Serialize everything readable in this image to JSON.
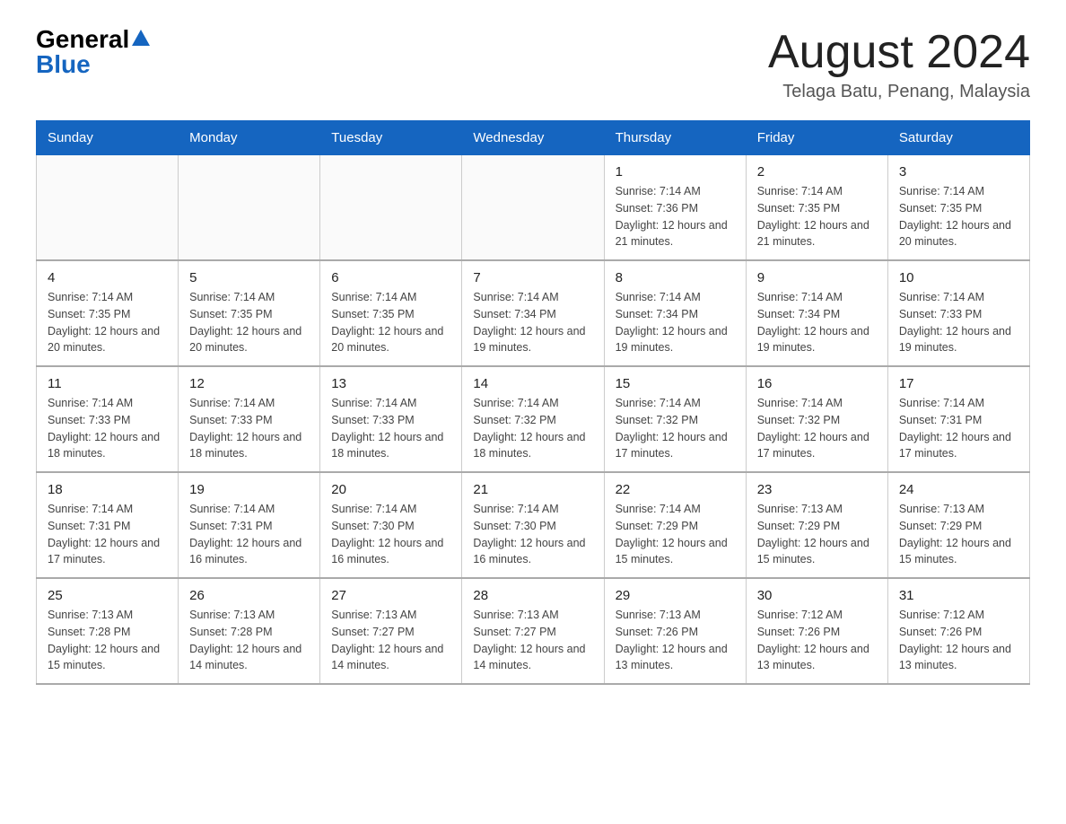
{
  "header": {
    "logo_text_general": "General",
    "logo_text_blue": "Blue",
    "title": "August 2024",
    "subtitle": "Telaga Batu, Penang, Malaysia"
  },
  "days_of_week": [
    "Sunday",
    "Monday",
    "Tuesday",
    "Wednesday",
    "Thursday",
    "Friday",
    "Saturday"
  ],
  "weeks": [
    [
      {
        "day": "",
        "info": ""
      },
      {
        "day": "",
        "info": ""
      },
      {
        "day": "",
        "info": ""
      },
      {
        "day": "",
        "info": ""
      },
      {
        "day": "1",
        "info": "Sunrise: 7:14 AM\nSunset: 7:36 PM\nDaylight: 12 hours and 21 minutes."
      },
      {
        "day": "2",
        "info": "Sunrise: 7:14 AM\nSunset: 7:35 PM\nDaylight: 12 hours and 21 minutes."
      },
      {
        "day": "3",
        "info": "Sunrise: 7:14 AM\nSunset: 7:35 PM\nDaylight: 12 hours and 20 minutes."
      }
    ],
    [
      {
        "day": "4",
        "info": "Sunrise: 7:14 AM\nSunset: 7:35 PM\nDaylight: 12 hours and 20 minutes."
      },
      {
        "day": "5",
        "info": "Sunrise: 7:14 AM\nSunset: 7:35 PM\nDaylight: 12 hours and 20 minutes."
      },
      {
        "day": "6",
        "info": "Sunrise: 7:14 AM\nSunset: 7:35 PM\nDaylight: 12 hours and 20 minutes."
      },
      {
        "day": "7",
        "info": "Sunrise: 7:14 AM\nSunset: 7:34 PM\nDaylight: 12 hours and 19 minutes."
      },
      {
        "day": "8",
        "info": "Sunrise: 7:14 AM\nSunset: 7:34 PM\nDaylight: 12 hours and 19 minutes."
      },
      {
        "day": "9",
        "info": "Sunrise: 7:14 AM\nSunset: 7:34 PM\nDaylight: 12 hours and 19 minutes."
      },
      {
        "day": "10",
        "info": "Sunrise: 7:14 AM\nSunset: 7:33 PM\nDaylight: 12 hours and 19 minutes."
      }
    ],
    [
      {
        "day": "11",
        "info": "Sunrise: 7:14 AM\nSunset: 7:33 PM\nDaylight: 12 hours and 18 minutes."
      },
      {
        "day": "12",
        "info": "Sunrise: 7:14 AM\nSunset: 7:33 PM\nDaylight: 12 hours and 18 minutes."
      },
      {
        "day": "13",
        "info": "Sunrise: 7:14 AM\nSunset: 7:33 PM\nDaylight: 12 hours and 18 minutes."
      },
      {
        "day": "14",
        "info": "Sunrise: 7:14 AM\nSunset: 7:32 PM\nDaylight: 12 hours and 18 minutes."
      },
      {
        "day": "15",
        "info": "Sunrise: 7:14 AM\nSunset: 7:32 PM\nDaylight: 12 hours and 17 minutes."
      },
      {
        "day": "16",
        "info": "Sunrise: 7:14 AM\nSunset: 7:32 PM\nDaylight: 12 hours and 17 minutes."
      },
      {
        "day": "17",
        "info": "Sunrise: 7:14 AM\nSunset: 7:31 PM\nDaylight: 12 hours and 17 minutes."
      }
    ],
    [
      {
        "day": "18",
        "info": "Sunrise: 7:14 AM\nSunset: 7:31 PM\nDaylight: 12 hours and 17 minutes."
      },
      {
        "day": "19",
        "info": "Sunrise: 7:14 AM\nSunset: 7:31 PM\nDaylight: 12 hours and 16 minutes."
      },
      {
        "day": "20",
        "info": "Sunrise: 7:14 AM\nSunset: 7:30 PM\nDaylight: 12 hours and 16 minutes."
      },
      {
        "day": "21",
        "info": "Sunrise: 7:14 AM\nSunset: 7:30 PM\nDaylight: 12 hours and 16 minutes."
      },
      {
        "day": "22",
        "info": "Sunrise: 7:14 AM\nSunset: 7:29 PM\nDaylight: 12 hours and 15 minutes."
      },
      {
        "day": "23",
        "info": "Sunrise: 7:13 AM\nSunset: 7:29 PM\nDaylight: 12 hours and 15 minutes."
      },
      {
        "day": "24",
        "info": "Sunrise: 7:13 AM\nSunset: 7:29 PM\nDaylight: 12 hours and 15 minutes."
      }
    ],
    [
      {
        "day": "25",
        "info": "Sunrise: 7:13 AM\nSunset: 7:28 PM\nDaylight: 12 hours and 15 minutes."
      },
      {
        "day": "26",
        "info": "Sunrise: 7:13 AM\nSunset: 7:28 PM\nDaylight: 12 hours and 14 minutes."
      },
      {
        "day": "27",
        "info": "Sunrise: 7:13 AM\nSunset: 7:27 PM\nDaylight: 12 hours and 14 minutes."
      },
      {
        "day": "28",
        "info": "Sunrise: 7:13 AM\nSunset: 7:27 PM\nDaylight: 12 hours and 14 minutes."
      },
      {
        "day": "29",
        "info": "Sunrise: 7:13 AM\nSunset: 7:26 PM\nDaylight: 12 hours and 13 minutes."
      },
      {
        "day": "30",
        "info": "Sunrise: 7:12 AM\nSunset: 7:26 PM\nDaylight: 12 hours and 13 minutes."
      },
      {
        "day": "31",
        "info": "Sunrise: 7:12 AM\nSunset: 7:26 PM\nDaylight: 12 hours and 13 minutes."
      }
    ]
  ]
}
